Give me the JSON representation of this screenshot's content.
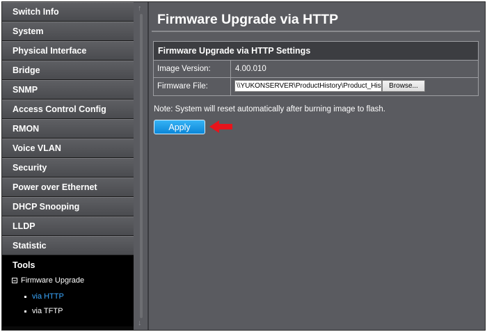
{
  "sidebar": {
    "items": [
      {
        "label": "Switch Info"
      },
      {
        "label": "System"
      },
      {
        "label": "Physical Interface"
      },
      {
        "label": "Bridge"
      },
      {
        "label": "SNMP"
      },
      {
        "label": "Access Control Config"
      },
      {
        "label": "RMON"
      },
      {
        "label": "Voice VLAN"
      },
      {
        "label": "Security"
      },
      {
        "label": "Power over Ethernet"
      },
      {
        "label": "DHCP Snooping"
      },
      {
        "label": "LLDP"
      },
      {
        "label": "Statistic"
      },
      {
        "label": "Tools"
      }
    ],
    "tools_sub": {
      "label": "Firmware Upgrade",
      "children": [
        {
          "label": "via HTTP"
        },
        {
          "label": "via TFTP"
        }
      ]
    }
  },
  "page": {
    "title": "Firmware Upgrade via HTTP",
    "settings_header": "Firmware Upgrade via HTTP Settings",
    "image_version_label": "Image Version:",
    "image_version_value": "4.00.010",
    "firmware_file_label": "Firmware File:",
    "firmware_file_value": "\\\\YUKONSERVER\\ProductHistory\\Product_History",
    "browse_label": "Browse...",
    "note": "Note: System will reset automatically after burning image to flash.",
    "apply_label": "Apply"
  },
  "colors": {
    "accent": "#0b86d8",
    "active_link": "#3aa8ff",
    "arrow": "#e8141b"
  }
}
